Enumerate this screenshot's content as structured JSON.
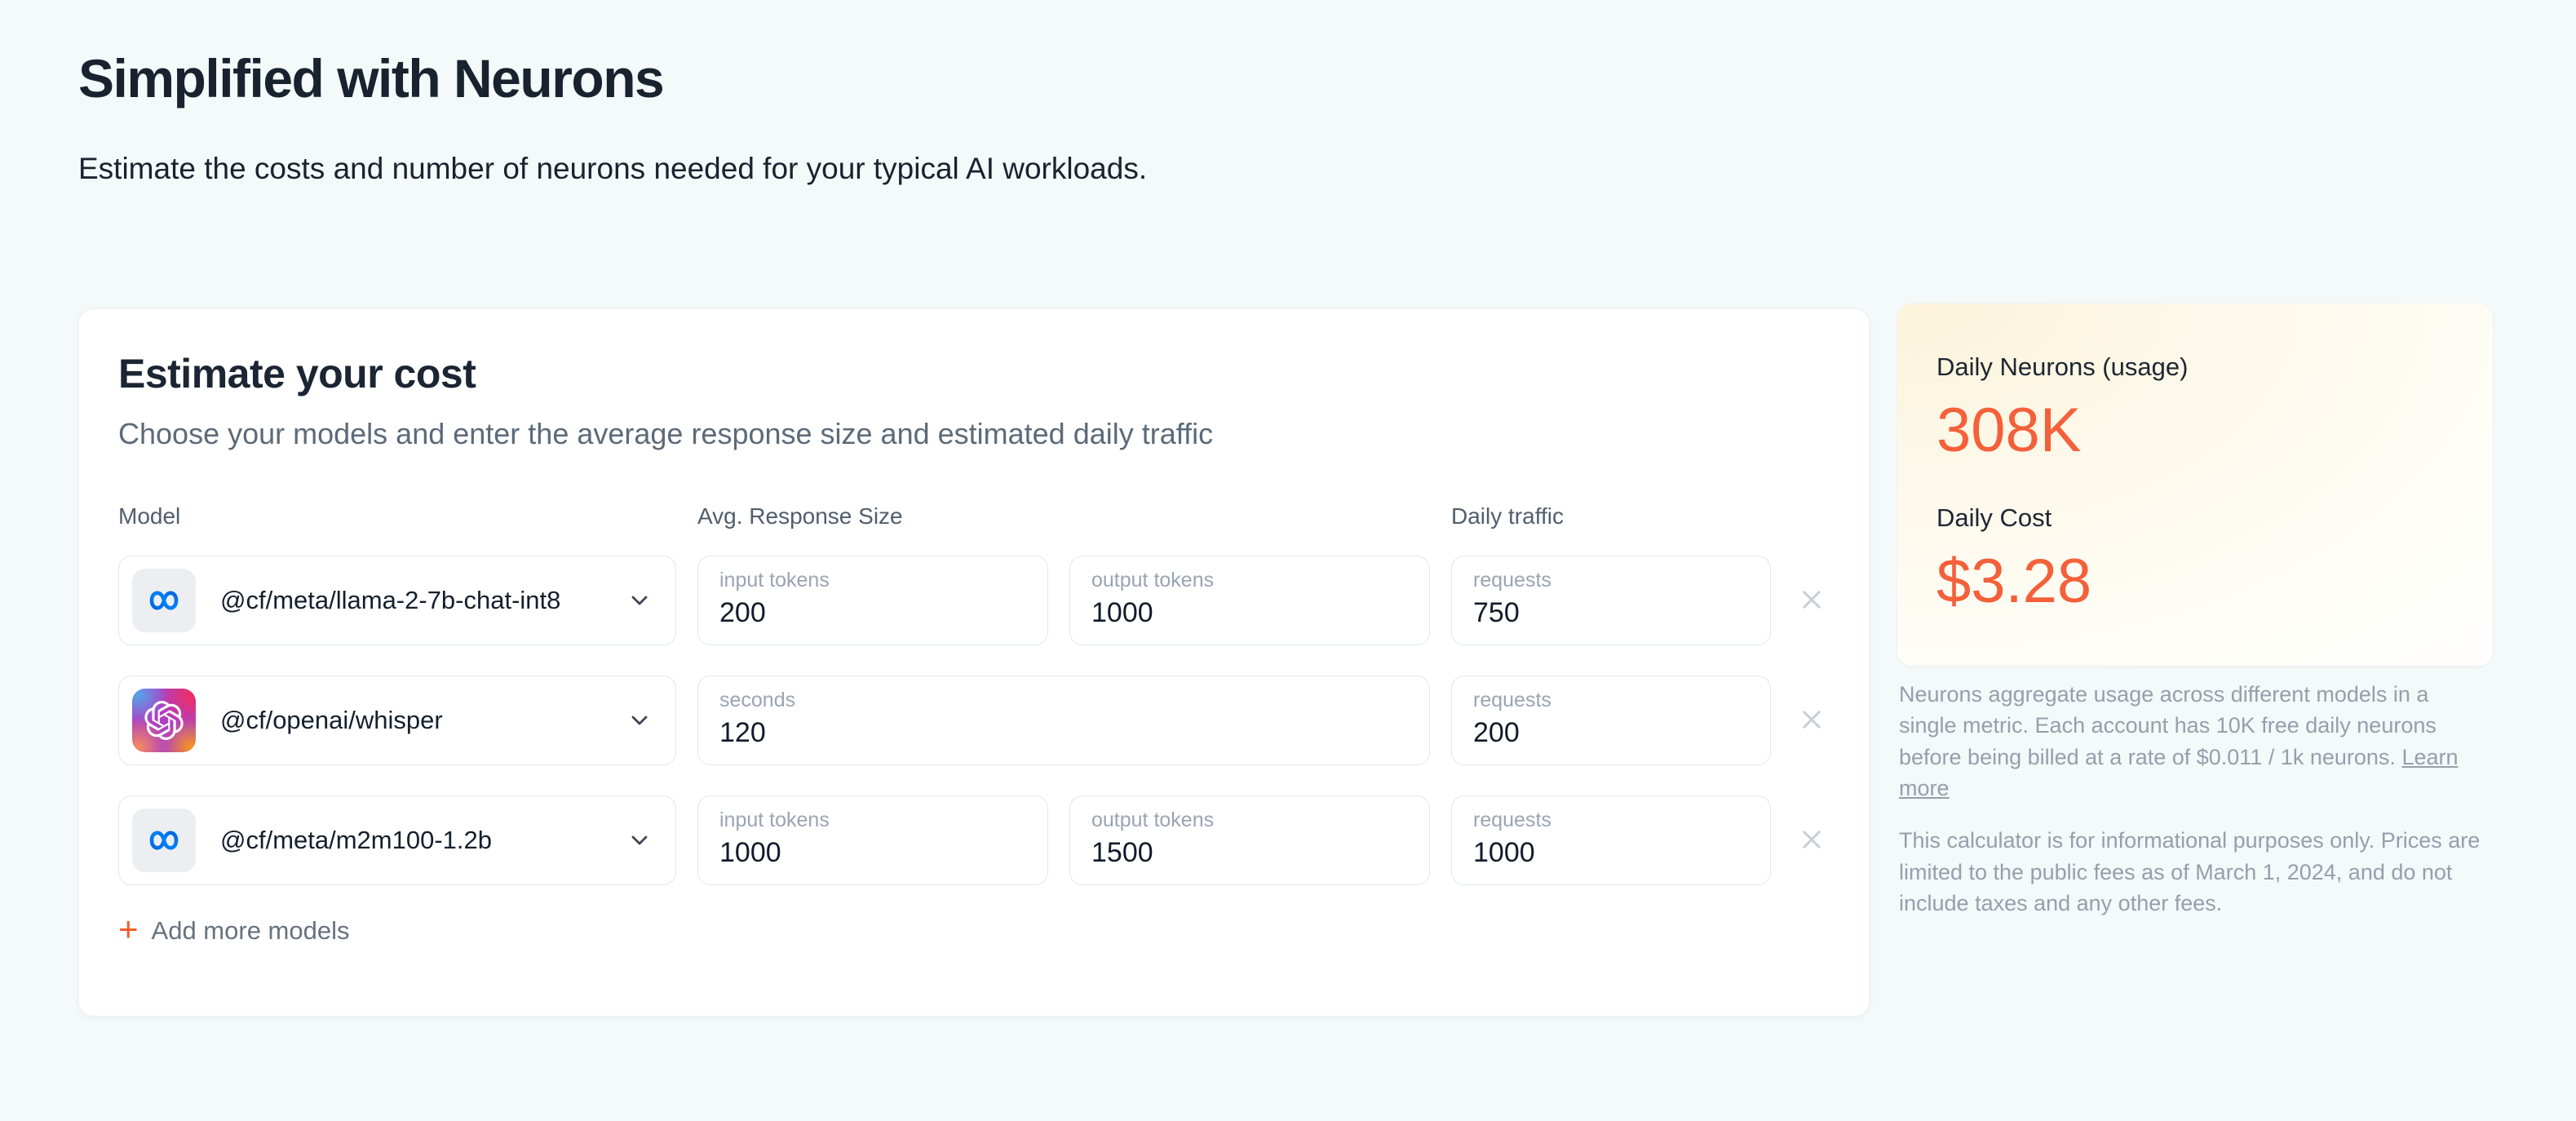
{
  "page": {
    "title": "Simplified with Neurons",
    "subtitle": "Estimate the costs and number of neurons needed for your typical AI workloads."
  },
  "calculator": {
    "title": "Estimate your cost",
    "subtitle": "Choose your models and enter the average response size and estimated daily traffic",
    "columns": {
      "model": "Model",
      "avg_response": "Avg. Response Size",
      "daily_traffic": "Daily traffic"
    },
    "rows": [
      {
        "icon": "meta-icon",
        "model": "@cf/meta/llama-2-7b-chat-int8",
        "fields": [
          {
            "label": "input tokens",
            "value": "200"
          },
          {
            "label": "output tokens",
            "value": "1000"
          }
        ],
        "traffic": {
          "label": "requests",
          "value": "750"
        }
      },
      {
        "icon": "openai-icon",
        "model": "@cf/openai/whisper",
        "fields": [
          {
            "label": "seconds",
            "value": "120",
            "wide": true
          }
        ],
        "traffic": {
          "label": "requests",
          "value": "200"
        }
      },
      {
        "icon": "meta-icon",
        "model": "@cf/meta/m2m100-1.2b",
        "fields": [
          {
            "label": "input tokens",
            "value": "1000"
          },
          {
            "label": "output tokens",
            "value": "1500"
          }
        ],
        "traffic": {
          "label": "requests",
          "value": "1000"
        }
      }
    ],
    "add_more_label": "Add more models"
  },
  "summary": {
    "neurons_label": "Daily Neurons (usage)",
    "neurons_value": "308K",
    "cost_label": "Daily Cost",
    "cost_value": "$3.28"
  },
  "footnotes": {
    "p1": "Neurons aggregate usage across different models in a single metric. Each account has 10K free daily neurons before being billed at a rate of $0.011 / 1k neurons.",
    "learn_more": "Learn more",
    "p2": "This calculator is for informational purposes only. Prices are limited to the public fees as of March 1, 2024, and do not include taxes and any other fees."
  },
  "colors": {
    "accent_orange": "#f4603a",
    "plus_orange": "#f25c2a",
    "meta_blue": "#0668E1",
    "page_background": "#f4f9f9",
    "summary_cream": "#fcf3da"
  }
}
